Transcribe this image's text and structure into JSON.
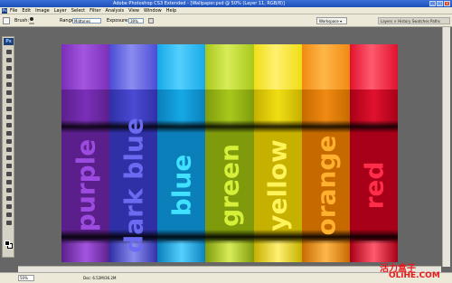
{
  "window": {
    "title": "Adobe Photoshop CS3 Extended - [Wallpaper.psd @ 50% (Layer 11, RGB/8)]"
  },
  "menubar": {
    "items": [
      "File",
      "Edit",
      "Image",
      "Layer",
      "Select",
      "Filter",
      "Analysis",
      "View",
      "Window",
      "Help"
    ]
  },
  "options": {
    "brush_label": "Brush:",
    "brush_size": "200",
    "range_label": "Range:",
    "range_value": "Midtones",
    "exposure_label": "Exposure:",
    "exposure_value": "39%",
    "workspace_label": "Workspace ▾",
    "panel_tabs": "Layers × History  Swatches  Paths"
  },
  "canvas": {
    "stripes": [
      {
        "word": "purple",
        "color": "#7a2fb8",
        "cap": "#a455e0",
        "body": "#5b1f8c",
        "text": "#9c4be0"
      },
      {
        "word": "dark blue",
        "color": "#4a4bd4",
        "cap": "#8b8cf0",
        "body": "#2f2fa6",
        "text": "#6a6bf0"
      },
      {
        "word": "blue",
        "color": "#16a9e6",
        "cap": "#54cfff",
        "body": "#0a7fba",
        "text": "#3fe1ff"
      },
      {
        "word": "green",
        "color": "#a8c81c",
        "cap": "#d8ec58",
        "body": "#7f9b0c",
        "text": "#d6f03a"
      },
      {
        "word": "yellow",
        "color": "#f0de14",
        "cap": "#fff070",
        "body": "#c6b000",
        "text": "#fff35a"
      },
      {
        "word": "orange",
        "color": "#f08a12",
        "cap": "#ffb74a",
        "body": "#c66a00",
        "text": "#ffb02e"
      },
      {
        "word": "red",
        "color": "#e0122e",
        "cap": "#ff5a6e",
        "body": "#a80018",
        "text": "#ff2c4a"
      }
    ]
  },
  "status": {
    "zoom": "50%",
    "doc": "Doc: 6.52M/36.2M",
    "watermark_cn": "活力盒子",
    "watermark_en": "OLiHE.COM"
  }
}
